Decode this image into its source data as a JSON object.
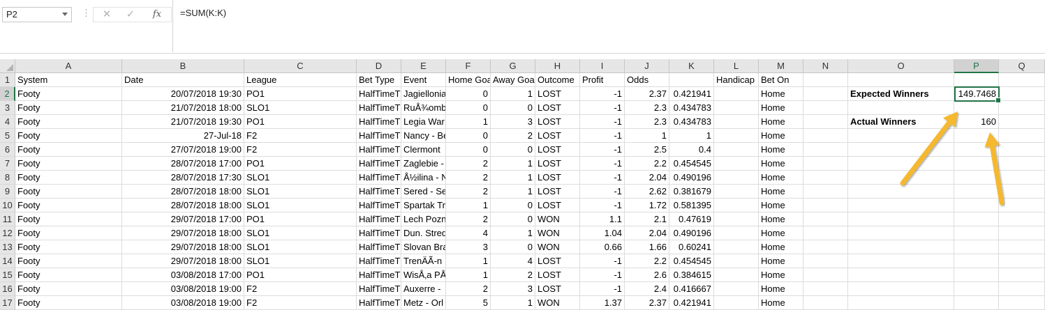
{
  "formula_bar": {
    "name_box": "P2",
    "cancel_icon": "✕",
    "enter_icon": "✓",
    "fx_label": "fx",
    "formula": "=SUM(K:K)"
  },
  "columns": [
    "A",
    "B",
    "C",
    "D",
    "E",
    "F",
    "G",
    "H",
    "I",
    "J",
    "K",
    "L",
    "M",
    "N",
    "O",
    "P",
    "Q"
  ],
  "selected_column": "P",
  "selected_row": "2",
  "headers": [
    "System",
    "Date",
    "League",
    "Bet Type",
    "Event",
    "Home Goals",
    "Away Goals",
    "Outcome",
    "Profit",
    "Odds",
    "",
    "Handicap",
    "Bet On"
  ],
  "rows": [
    [
      "Footy",
      "20/07/2018 19:30",
      "PO1",
      "HalfTimeT",
      "Jagiellonia",
      "0",
      "1",
      "LOST",
      "-1",
      "2.37",
      "0.421941",
      "",
      "Home"
    ],
    [
      "Footy",
      "21/07/2018 18:00",
      "SLO1",
      "HalfTimeT",
      "RuÅ¾omb",
      "0",
      "0",
      "LOST",
      "-1",
      "2.3",
      "0.434783",
      "",
      "Home"
    ],
    [
      "Footy",
      "21/07/2018 19:30",
      "PO1",
      "HalfTimeT",
      "Legia War",
      "1",
      "3",
      "LOST",
      "-1",
      "2.3",
      "0.434783",
      "",
      "Home"
    ],
    [
      "Footy",
      "27-Jul-18",
      "F2",
      "HalfTimeT",
      "Nancy - Be",
      "0",
      "2",
      "LOST",
      "-1",
      "1",
      "1",
      "",
      "Home"
    ],
    [
      "Footy",
      "27/07/2018 19:00",
      "F2",
      "HalfTimeT",
      "Clermont",
      "0",
      "0",
      "LOST",
      "-1",
      "2.5",
      "0.4",
      "",
      "Home"
    ],
    [
      "Footy",
      "28/07/2018 17:00",
      "PO1",
      "HalfTimeT",
      "Zaglebie -",
      "2",
      "1",
      "LOST",
      "-1",
      "2.2",
      "0.454545",
      "",
      "Home"
    ],
    [
      "Footy",
      "28/07/2018 17:30",
      "SLO1",
      "HalfTimeT",
      "Å½ilina - N",
      "2",
      "1",
      "LOST",
      "-1",
      "2.04",
      "0.490196",
      "",
      "Home"
    ],
    [
      "Footy",
      "28/07/2018 18:00",
      "SLO1",
      "HalfTimeT",
      "Sered - Se",
      "2",
      "1",
      "LOST",
      "-1",
      "2.62",
      "0.381679",
      "",
      "Home"
    ],
    [
      "Footy",
      "28/07/2018 18:00",
      "SLO1",
      "HalfTimeT",
      "Spartak Tr",
      "1",
      "0",
      "LOST",
      "-1",
      "1.72",
      "0.581395",
      "",
      "Home"
    ],
    [
      "Footy",
      "29/07/2018 17:00",
      "PO1",
      "HalfTimeT",
      "Lech Pozn",
      "2",
      "0",
      "WON",
      "1.1",
      "2.1",
      "0.47619",
      "",
      "Home"
    ],
    [
      "Footy",
      "29/07/2018 18:00",
      "SLO1",
      "HalfTimeT",
      "Dun. Streda",
      "4",
      "1",
      "WON",
      "1.04",
      "2.04",
      "0.490196",
      "",
      "Home"
    ],
    [
      "Footy",
      "29/07/2018 18:00",
      "SLO1",
      "HalfTimeT",
      "Slovan Bra",
      "3",
      "0",
      "WON",
      "0.66",
      "1.66",
      "0.60241",
      "",
      "Home"
    ],
    [
      "Footy",
      "29/07/2018 18:00",
      "SLO1",
      "HalfTimeT",
      "TrenÄÃ-n",
      "1",
      "4",
      "LOST",
      "-1",
      "2.2",
      "0.454545",
      "",
      "Home"
    ],
    [
      "Footy",
      "03/08/2018 17:00",
      "PO1",
      "HalfTimeT",
      "WisÅ‚a PÅ",
      "1",
      "2",
      "LOST",
      "-1",
      "2.6",
      "0.384615",
      "",
      "Home"
    ],
    [
      "Footy",
      "03/08/2018 19:00",
      "F2",
      "HalfTimeT",
      "Auxerre -",
      "2",
      "3",
      "LOST",
      "-1",
      "2.4",
      "0.416667",
      "",
      "Home"
    ],
    [
      "Footy",
      "03/08/2018 19:00",
      "F2",
      "HalfTimeT",
      "Metz - Orl",
      "5",
      "1",
      "WON",
      "1.37",
      "2.37",
      "0.421941",
      "",
      "Home"
    ]
  ],
  "summary": {
    "expected_label": "Expected Winners",
    "expected_value": "149.7468",
    "actual_label": "Actual Winners",
    "actual_value": "160"
  },
  "annotation_color": "#f5b82e"
}
